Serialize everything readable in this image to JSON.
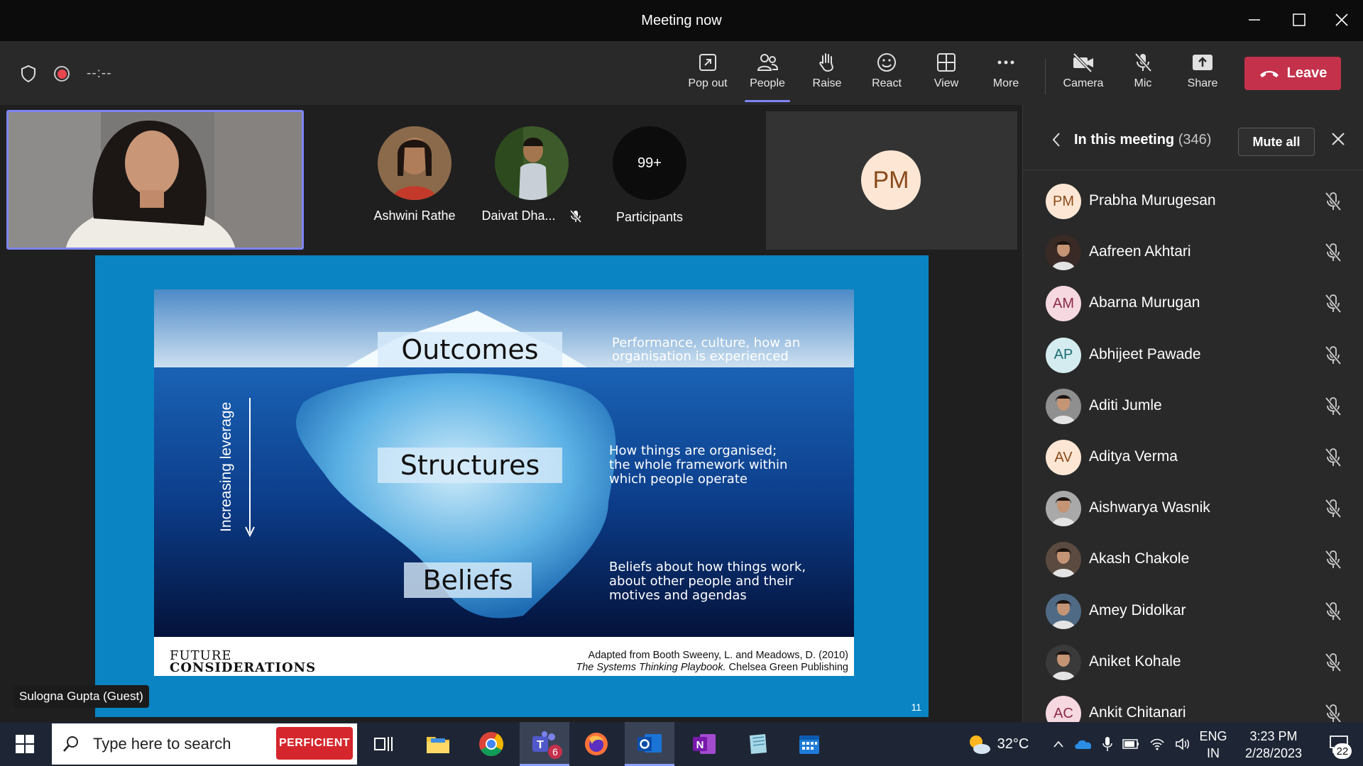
{
  "window": {
    "title": "Meeting now"
  },
  "toolbar": {
    "timer": "--:--",
    "buttons": [
      {
        "label": "Pop out",
        "icon": "pop-out-icon"
      },
      {
        "label": "People",
        "icon": "people-icon"
      },
      {
        "label": "Raise",
        "icon": "raise-hand-icon"
      },
      {
        "label": "React",
        "icon": "react-icon"
      },
      {
        "label": "View",
        "icon": "view-icon"
      },
      {
        "label": "More",
        "icon": "more-icon"
      },
      {
        "label": "Camera",
        "icon": "camera-off-icon"
      },
      {
        "label": "Mic",
        "icon": "mic-off-icon"
      },
      {
        "label": "Share",
        "icon": "share-icon"
      }
    ],
    "leave_label": "Leave",
    "active": "People"
  },
  "stage": {
    "participants": [
      {
        "name": "Ashwini Rathe"
      },
      {
        "name": "Daivat Dha..."
      },
      {
        "name": "Participants",
        "badge": "99+"
      }
    ],
    "pm_tile_initials": "PM",
    "presenter_tag": "Sulogna Gupta (Guest)",
    "slide": {
      "labels": [
        "Outcomes",
        "Structures",
        "Beliefs"
      ],
      "desc_outcomes": [
        "Performance, culture, how an",
        "organisation is experienced"
      ],
      "desc_structures": [
        "How things are organised;",
        "the whole framework within",
        "which people operate"
      ],
      "desc_beliefs": [
        "Beliefs about how things work,",
        "about other people and their",
        "motives and agendas"
      ],
      "side_label": "Increasing leverage",
      "logo_line1": "FUTURE",
      "logo_line2": "CONSIDERATIONS",
      "credit_line1": "Adapted from Booth Sweeny, L. and Meadows, D. (2010)",
      "credit_line2_italic": "The Systems Thinking Playbook.",
      "credit_line2_rest": " Chelsea Green Publishing",
      "page_number": "11"
    }
  },
  "panel": {
    "title": "In this meeting",
    "count": "(346)",
    "mute_all": "Mute all",
    "members": [
      {
        "name": "Prabha Murugesan",
        "initials": "PM",
        "bg": "#fde7d4",
        "fg": "#8a4b1b",
        "photo": false
      },
      {
        "name": "Aafreen Akhtari",
        "initials": "",
        "bg": "#3a2a25",
        "fg": "#fff",
        "photo": true
      },
      {
        "name": "Abarna Murugan",
        "initials": "AM",
        "bg": "#f6d8e0",
        "fg": "#8a2a45",
        "photo": false
      },
      {
        "name": "Abhijeet Pawade",
        "initials": "AP",
        "bg": "#d4ecef",
        "fg": "#1d6c76",
        "photo": false
      },
      {
        "name": "Aditi Jumle",
        "initials": "",
        "bg": "#8f8f8f",
        "fg": "#fff",
        "photo": true
      },
      {
        "name": "Aditya Verma",
        "initials": "AV",
        "bg": "#fde7d4",
        "fg": "#8a4b1b",
        "photo": false
      },
      {
        "name": "Aishwarya Wasnik",
        "initials": "",
        "bg": "#a9a9a9",
        "fg": "#fff",
        "photo": true
      },
      {
        "name": "Akash Chakole",
        "initials": "",
        "bg": "#5a4a40",
        "fg": "#fff",
        "photo": true
      },
      {
        "name": "Amey Didolkar",
        "initials": "",
        "bg": "#4f6a85",
        "fg": "#fff",
        "photo": true
      },
      {
        "name": "Aniket Kohale",
        "initials": "",
        "bg": "#3a3a3a",
        "fg": "#fff",
        "photo": true
      },
      {
        "name": "Ankit Chitanari",
        "initials": "AC",
        "bg": "#f6d8e0",
        "fg": "#8a2a45",
        "photo": false
      }
    ]
  },
  "taskbar": {
    "search_placeholder": "Type here to search",
    "search_badge": "PERFICIENT",
    "teams_badge": "6",
    "weather": "32°C",
    "lang_top": "ENG",
    "lang_bottom": "IN",
    "time": "3:23 PM",
    "date": "2/28/2023",
    "notifications": "22"
  },
  "colors": {
    "accent": "#7f85f5",
    "leave": "#c4314b",
    "slide_bg": "#0a84c2"
  }
}
